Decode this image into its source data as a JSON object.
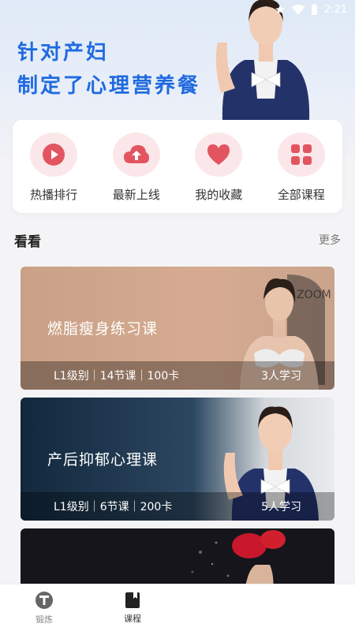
{
  "status": {
    "time": "2:21"
  },
  "banner": {
    "title_line1": "针对产妇",
    "title_line2": "制定了心理营养餐"
  },
  "menu": [
    {
      "label": "热播排行",
      "icon": "play-icon"
    },
    {
      "label": "最新上线",
      "icon": "cloud-upload-icon"
    },
    {
      "label": "我的收藏",
      "icon": "heart-icon"
    },
    {
      "label": "全部课程",
      "icon": "grid-icon"
    }
  ],
  "section": {
    "title": "看看",
    "more": "更多"
  },
  "courses": [
    {
      "title": "燃脂瘦身练习课",
      "meta": "L1级别｜14节课｜100卡",
      "students": "3人学习"
    },
    {
      "title": "产后抑郁心理课",
      "meta": "L1级别｜6节课｜200卡",
      "students": "5人学习"
    }
  ],
  "nav": [
    {
      "label": "锻炼",
      "icon": "workout-icon"
    },
    {
      "label": "课程",
      "icon": "book-icon"
    }
  ],
  "colors": {
    "accent": "#1f6ae0",
    "icon_bg": "#fbe7e9",
    "icon_fg": "#e25560"
  }
}
